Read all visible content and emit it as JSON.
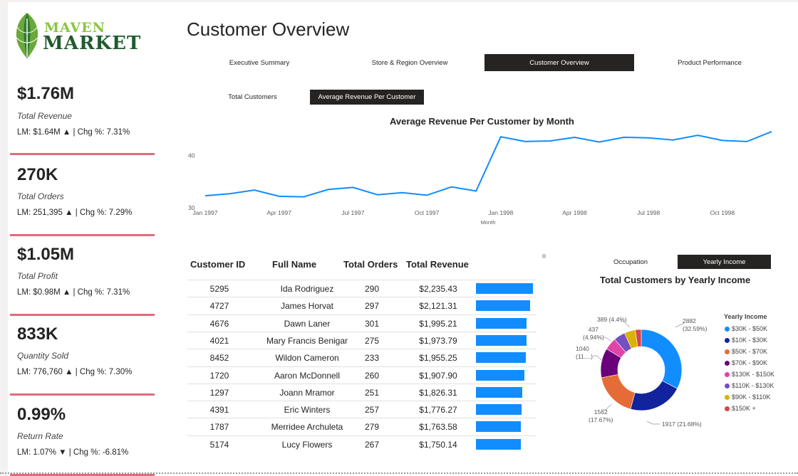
{
  "logo": {
    "word1": "MAVEN",
    "word2": "MARKET"
  },
  "page_title": "Customer Overview",
  "nav": {
    "tabs": [
      {
        "label": "Executive Summary",
        "active": false
      },
      {
        "label": "Store & Region Overview",
        "active": false
      },
      {
        "label": "Customer Overview",
        "active": true
      },
      {
        "label": "Product Performance",
        "active": false
      }
    ]
  },
  "kpis": [
    {
      "value": "$1.76M",
      "label": "Total Revenue",
      "sub": "LM: $1.64M ▲ | Chg %: 7.31%"
    },
    {
      "value": "270K",
      "label": "Total Orders",
      "sub": "LM: 251,395 ▲ | Chg %: 7.29%"
    },
    {
      "value": "$1.05M",
      "label": "Total Profit",
      "sub": "LM: $0.98M ▲ | Chg %: 7.31%"
    },
    {
      "value": "833K",
      "label": "Quantity Sold",
      "sub": "LM: 776,760 ▲ | Chg %: 7.30%"
    },
    {
      "value": "0.99%",
      "label": "Return Rate",
      "sub": "LM: 1.07% ▼ | Chg %: -6.81%"
    }
  ],
  "metric_toggle": {
    "options": [
      "Total Customers",
      "Average Revenue Per Customer"
    ],
    "active_index": 1
  },
  "income_toggle": {
    "options": [
      "Occupation",
      "Yearly Income"
    ],
    "active_index": 1
  },
  "line_chart_data": {
    "type": "line",
    "title": "Average Revenue Per Customer by Month",
    "xlabel": "Month",
    "ylabel": "",
    "x_ticks": [
      "Jan 1997",
      "Apr 1997",
      "Jul 1997",
      "Oct 1997",
      "Jan 1998",
      "Apr 1998",
      "Jul 1998",
      "Oct 1998"
    ],
    "y_ticks": [
      30,
      40
    ],
    "ylim": [
      30,
      45
    ],
    "x": [
      "Jan 1997",
      "Feb 1997",
      "Mar 1997",
      "Apr 1997",
      "May 1997",
      "Jun 1997",
      "Jul 1997",
      "Aug 1997",
      "Sep 1997",
      "Oct 1997",
      "Nov 1997",
      "Dec 1997",
      "Jan 1998",
      "Feb 1998",
      "Mar 1998",
      "Apr 1998",
      "May 1998",
      "Jun 1998",
      "Jul 1998",
      "Aug 1998",
      "Sep 1998",
      "Oct 1998",
      "Nov 1998",
      "Dec 1998"
    ],
    "values": [
      32.3,
      32.7,
      33.4,
      32.2,
      32.1,
      33.5,
      33.9,
      32.5,
      32.9,
      32.4,
      34.0,
      33.2,
      43.6,
      42.7,
      42.8,
      43.5,
      42.6,
      43.5,
      43.4,
      43.0,
      43.9,
      42.9,
      42.7,
      44.6
    ],
    "color": "#118dff"
  },
  "table": {
    "headers": [
      "Customer ID",
      "Full Name",
      "Total Orders",
      "Total Revenue"
    ],
    "rows": [
      {
        "id": "5295",
        "name": "Ida Rodriguez",
        "orders": "290",
        "revenue": "$2,235.43",
        "revenue_value": 2235.43
      },
      {
        "id": "4727",
        "name": "James Horvat",
        "orders": "297",
        "revenue": "$2,121.31",
        "revenue_value": 2121.31
      },
      {
        "id": "4676",
        "name": "Dawn Laner",
        "orders": "301",
        "revenue": "$1,995.21",
        "revenue_value": 1995.21
      },
      {
        "id": "4021",
        "name": "Mary Francis Benigar",
        "orders": "275",
        "revenue": "$1,973.79",
        "revenue_value": 1973.79
      },
      {
        "id": "8452",
        "name": "Wildon Cameron",
        "orders": "233",
        "revenue": "$1,955.25",
        "revenue_value": 1955.25
      },
      {
        "id": "1720",
        "name": "Aaron McDonnell",
        "orders": "260",
        "revenue": "$1,907.90",
        "revenue_value": 1907.9
      },
      {
        "id": "1297",
        "name": "Joann Mramor",
        "orders": "251",
        "revenue": "$1,826.31",
        "revenue_value": 1826.31
      },
      {
        "id": "4391",
        "name": "Eric Winters",
        "orders": "257",
        "revenue": "$1,776.27",
        "revenue_value": 1776.27
      },
      {
        "id": "1787",
        "name": "Merridee Archuleta",
        "orders": "279",
        "revenue": "$1,763.58",
        "revenue_value": 1763.58
      },
      {
        "id": "5174",
        "name": "Lucy Flowers",
        "orders": "267",
        "revenue": "$1,750.14",
        "revenue_value": 1750.14
      }
    ],
    "bar_color": "#118dff"
  },
  "chart_data": {
    "type": "pie",
    "title": "Total Customers by Yearly Income",
    "legend_title": "Yearly Income",
    "legend_position": "right",
    "series": [
      {
        "name": "$30K - $50K",
        "value": 2882,
        "label": "2882",
        "pct": "(32.59%)",
        "color": "#118dff"
      },
      {
        "name": "$10K - $30K",
        "value": 1917,
        "label": "1917 (21.68%)",
        "pct": "",
        "color": "#12239e"
      },
      {
        "name": "$50K - $70K",
        "value": 1562,
        "label": "1562",
        "pct": "(17.67%)",
        "color": "#e66c37"
      },
      {
        "name": "$70K - $90K",
        "value": 1040,
        "label": "1040",
        "pct": "(11....)",
        "color": "#6b007b"
      },
      {
        "name": "$130K - $150K",
        "value": 437,
        "label": "437",
        "pct": "(4.94%)",
        "color": "#e044a7"
      },
      {
        "name": "$110K - $130K",
        "value": 405,
        "label": "",
        "pct": "",
        "color": "#744ec2"
      },
      {
        "name": "$90K - $110K",
        "value": 389,
        "label": "389 (4.4%)",
        "pct": "",
        "color": "#d9b300"
      },
      {
        "name": "$150K +",
        "value": 210,
        "label": "",
        "pct": "",
        "color": "#d64550"
      }
    ]
  }
}
